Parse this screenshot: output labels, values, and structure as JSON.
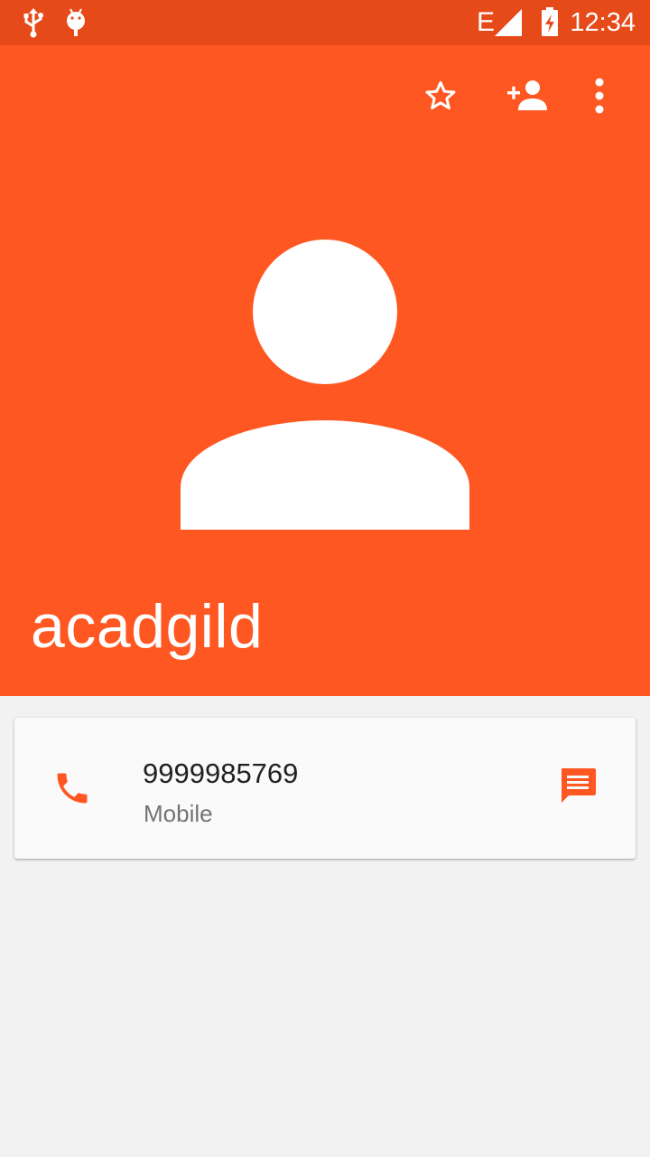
{
  "status_bar": {
    "time": "12:34",
    "icons": [
      "usb-icon",
      "android-debug-icon",
      "edge-signal-icon",
      "battery-charging-icon"
    ],
    "network_label": "E"
  },
  "header": {
    "actions": [
      {
        "name": "star-icon",
        "label": "Favorite"
      },
      {
        "name": "add-person-icon",
        "label": "Add contact"
      },
      {
        "name": "more-vert-icon",
        "label": "More options"
      }
    ],
    "avatar_icon": "person-placeholder-icon",
    "contact_name": "acadgild"
  },
  "contact_card": {
    "call_icon": "phone-icon",
    "number": "9999985769",
    "type": "Mobile",
    "message_icon": "message-icon"
  },
  "colors": {
    "status_bar": "#e64a19",
    "header": "#ff5722",
    "accent": "#ff5722",
    "background": "#f2f2f2",
    "card": "#fafafa"
  }
}
